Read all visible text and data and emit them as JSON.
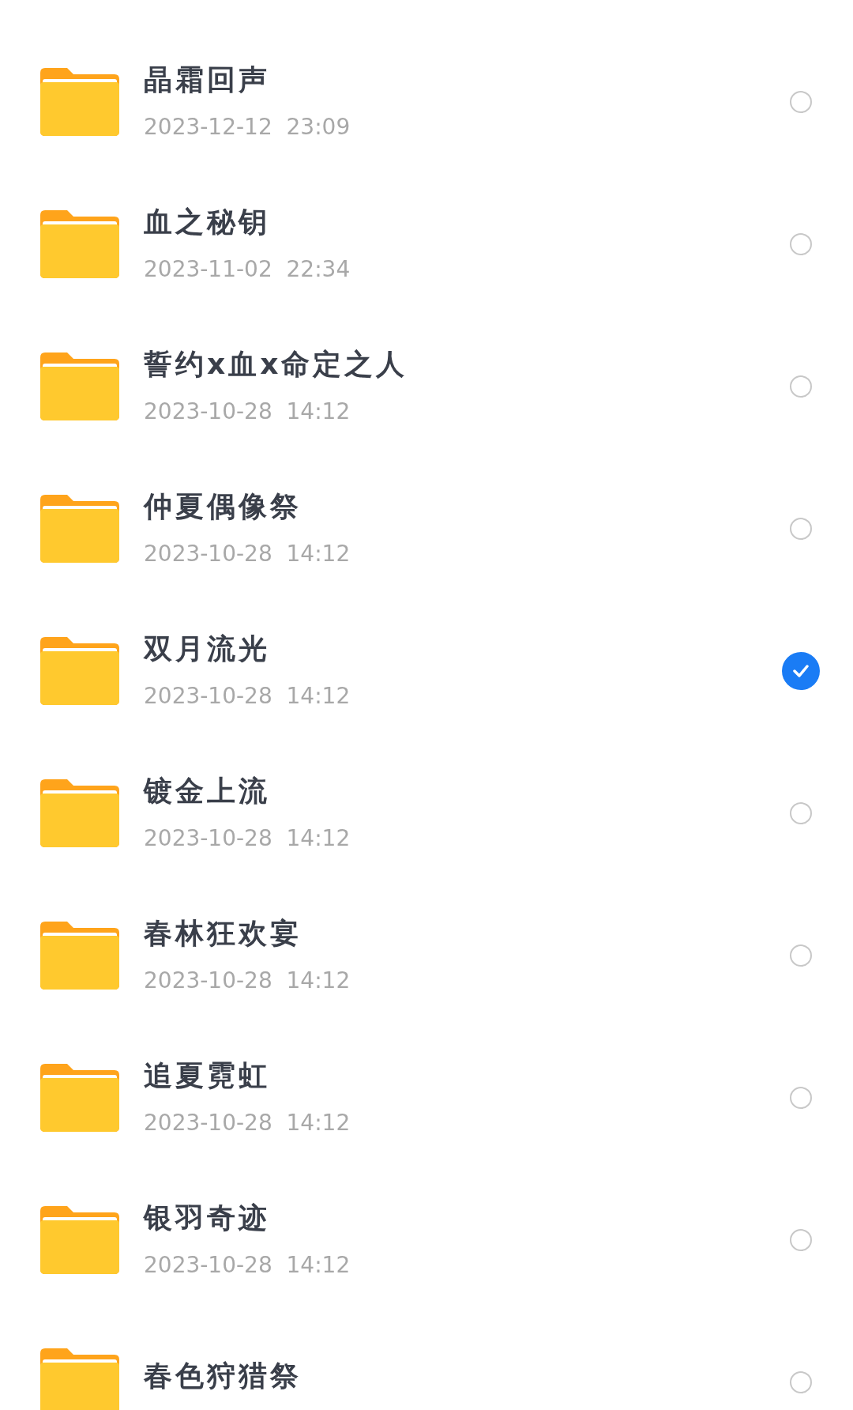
{
  "folders": [
    {
      "name": "晶霜回声",
      "date": "2023-12-12  23:09",
      "selected": false
    },
    {
      "name": "血之秘钥",
      "date": "2023-11-02  22:34",
      "selected": false
    },
    {
      "name": "誓约x血x命定之人",
      "date": "2023-10-28  14:12",
      "selected": false
    },
    {
      "name": "仲夏偶像祭",
      "date": "2023-10-28  14:12",
      "selected": false
    },
    {
      "name": "双月流光",
      "date": "2023-10-28  14:12",
      "selected": true
    },
    {
      "name": "镀金上流",
      "date": "2023-10-28  14:12",
      "selected": false
    },
    {
      "name": "春林狂欢宴",
      "date": "2023-10-28  14:12",
      "selected": false
    },
    {
      "name": "追夏霓虹",
      "date": "2023-10-28  14:12",
      "selected": false
    },
    {
      "name": "银羽奇迹",
      "date": "2023-10-28  14:12",
      "selected": false
    },
    {
      "name": "春色狩猎祭",
      "selected": false
    }
  ]
}
